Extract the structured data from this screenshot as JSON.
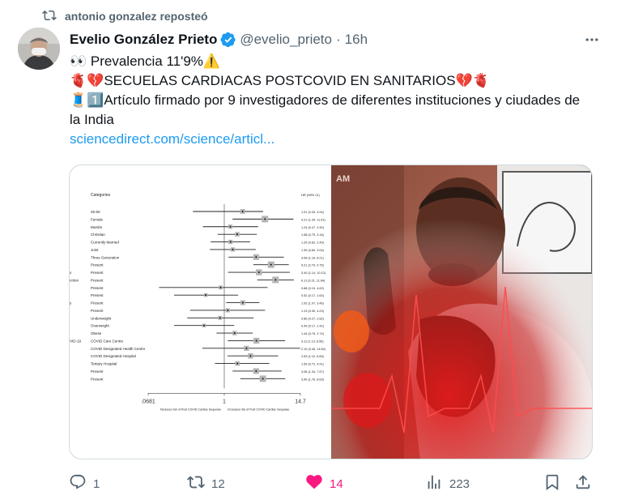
{
  "repost": {
    "text": "antonio gonzalez reposteó",
    "icon": "repost-icon"
  },
  "author": {
    "name": "Evelio González Prieto",
    "handle": "@evelio_prieto",
    "separator": "·",
    "time": "16h"
  },
  "tweet": {
    "line1_eyes": "👀",
    "line1": " Prevalencia 11'9%",
    "line1_warn": "⚠️",
    "line2_start": "🫀💔",
    "line2": "SECUELAS CARDIACAS POSTCOVID EN SANITARIOS",
    "line2_end": "💔🫀",
    "line3_emoji": "🧵1️⃣",
    "line3": "Artículo firmado por 9 investigadores de diferentes instituciones y ciudades de la India",
    "link": "sciencedirect.com/science/articl..."
  },
  "forest_plot": {
    "categories_header": "Categories",
    "hr_header": "HR (95% CI)",
    "rows": [
      {
        "label": "45-60",
        "hr": "1.91 (0.33, 3.94)"
      },
      {
        "label": "Female",
        "hr": "4.21 (1.34, 11.51)"
      },
      {
        "label": "Muslim",
        "hr": "1.24 (0.47, 3.30)"
      },
      {
        "label": "Christian",
        "hr": "1.58 (0.79, 3.16)"
      },
      {
        "label": "Currently Married",
        "hr": "1.25 (0.62, 2.49)"
      },
      {
        "label": "Joint",
        "hr": "1.35 (0.60, 3.04)"
      },
      {
        "label": "Three Generation",
        "hr": "3.08 (1.16, 8.21)"
      },
      {
        "label": "Present",
        "hr": "5.21 (2.79, 9.75)"
      },
      {
        "label": "Present",
        "hr": "3.40 (1.14, 10.12)"
      },
      {
        "label": "Present",
        "hr": "6.11 (3.21, 11.64)"
      },
      {
        "label": "Present",
        "hr": "0.88 (0.10, 4.62)"
      },
      {
        "label": "Present",
        "hr": "0.52 (0.17, 1.63)"
      },
      {
        "label": "Present",
        "hr": "1.92 (1.07, 3.46)"
      },
      {
        "label": "Present",
        "hr": "1.13 (0.30, 4.23)"
      },
      {
        "label": "Underweight",
        "hr": "0.86 (0.27, 2.82)"
      },
      {
        "label": "Overweight",
        "hr": "0.49 (0.17, 1.42)"
      },
      {
        "label": "Obese",
        "hr": "1.44 (0.76, 2.74)"
      },
      {
        "label": "COVID Care Centre",
        "hr": "3.11 (1.13, 8.56)"
      },
      {
        "label": "COVID Designated Health Centre",
        "hr": "2.19 (0.46, 14.60)"
      },
      {
        "label": "COVID Designated Hospital",
        "hr": "2.53 (1.12, 6.69)"
      },
      {
        "label": "Tertiary Hospital",
        "hr": "1.59 (0.72, 4.91)"
      },
      {
        "label": "Present",
        "hr": "3.08 (1.34, 7.57)"
      },
      {
        "label": "Present",
        "hr": "3.90 (1.76, 8.63)"
      }
    ],
    "side_fragments": [
      "s",
      "rction",
      "y",
      "VID-19"
    ],
    "ticks": [
      ".0681",
      "1",
      "14.7"
    ],
    "tick_values": [
      0.0681,
      1,
      14.7
    ],
    "xlabel_left": "Reduces risk of Post COVID Cardiac Sequelae",
    "xlabel_right": "Increases risk of Post COVID Cardiac Sequelae"
  },
  "photo_caption": "AM",
  "actions": {
    "reply": {
      "count": "1",
      "icon": "reply-icon"
    },
    "repost": {
      "count": "12",
      "icon": "repost-icon"
    },
    "like": {
      "count": "14",
      "icon": "heart-icon",
      "color": "#f91880"
    },
    "views": {
      "count": "223",
      "icon": "views-icon"
    },
    "bookmark": {
      "icon": "bookmark-icon"
    },
    "share": {
      "icon": "share-icon"
    }
  },
  "colors": {
    "link": "#1d9bf0",
    "secondary": "#536471",
    "verified": "#1d9bf0",
    "like": "#f91880"
  }
}
